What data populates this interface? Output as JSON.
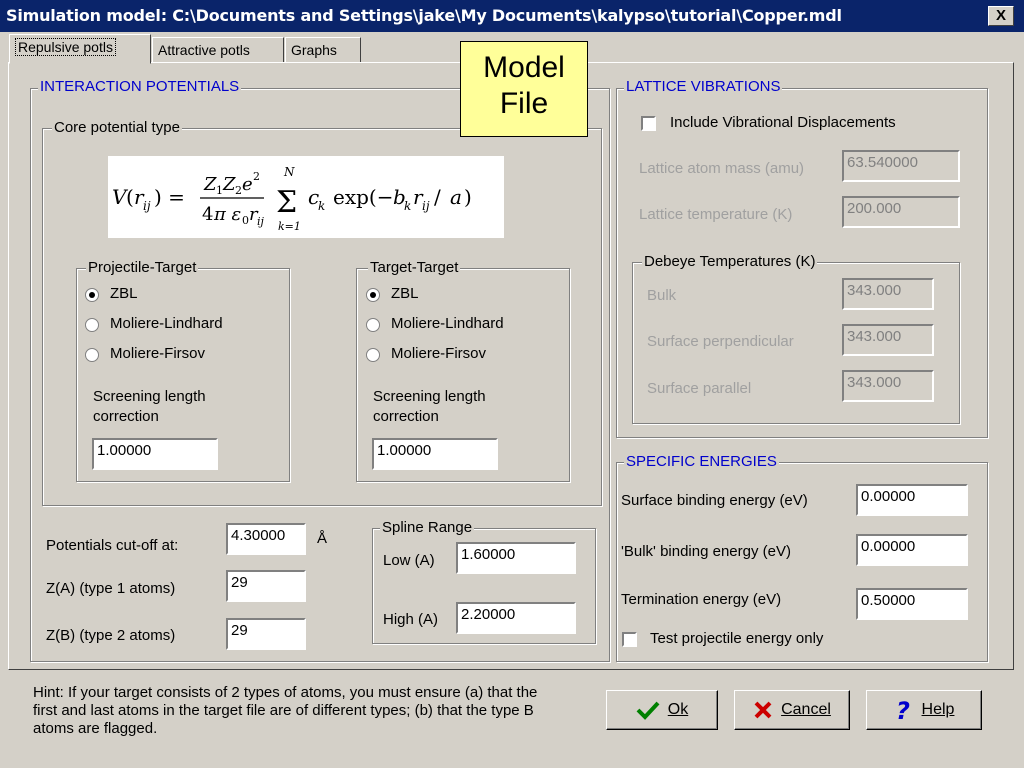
{
  "window": {
    "title": "Simulation model: C:\\Documents and Settings\\jake\\My Documents\\kalypso\\tutorial\\Copper.mdl",
    "close_label": "X"
  },
  "tabs": [
    {
      "label": "Repulsive potls"
    },
    {
      "label": "Attractive potls"
    },
    {
      "label": "Graphs"
    }
  ],
  "callout": {
    "line1": "Model",
    "line2": "File"
  },
  "interaction": {
    "title": "INTERACTION POTENTIALS",
    "core": {
      "title": "Core potential type",
      "formula": "V(r_ij) = Z1 Z2 e^2 / (4 pi eps0 r_ij) * sum_{k=1}^{N} c_k exp(-b_k r_ij / a)",
      "projectile_target": {
        "title": "Projectile-Target",
        "options": [
          "ZBL",
          "Moliere-Lindhard",
          "Moliere-Firsov"
        ],
        "selected": "ZBL",
        "screening_label_1": "Screening length",
        "screening_label_2": "correction",
        "screening_value": "1.00000"
      },
      "target_target": {
        "title": "Target-Target",
        "options": [
          "ZBL",
          "Moliere-Lindhard",
          "Moliere-Firsov"
        ],
        "selected": "ZBL",
        "screening_label_1": "Screening length",
        "screening_label_2": "correction",
        "screening_value": "1.00000"
      }
    },
    "cutoff_label": "Potentials cut-off at:",
    "cutoff_value": "4.30000",
    "cutoff_unit": "Å",
    "za_label": "Z(A) (type 1 atoms)",
    "za_value": "29",
    "zb_label": "Z(B) (type 2 atoms)",
    "zb_value": "29",
    "spline": {
      "title": "Spline Range",
      "low_label": "Low (A)",
      "low_value": "1.60000",
      "high_label": "High (A)",
      "high_value": "2.20000"
    }
  },
  "lattice": {
    "title": "LATTICE VIBRATIONS",
    "include_label": "Include Vibrational Displacements",
    "include_checked": false,
    "mass_label": "Lattice atom mass (amu)",
    "mass_value": "63.540000",
    "temp_label": "Lattice temperature (K)",
    "temp_value": "200.000",
    "debye": {
      "title": "Debeye Temperatures (K)",
      "bulk_label": "Bulk",
      "bulk_value": "343.000",
      "perp_label": "Surface perpendicular",
      "perp_value": "343.000",
      "par_label": "Surface parallel",
      "par_value": "343.000"
    }
  },
  "energies": {
    "title": "SPECIFIC ENERGIES",
    "surface_label": "Surface binding energy (eV)",
    "surface_value": "0.00000",
    "bulk_label": "'Bulk' binding energy (eV)",
    "bulk_value": "0.00000",
    "term_label": "Termination energy (eV)",
    "term_value": "0.50000",
    "test_label": "Test projectile energy only",
    "test_checked": false
  },
  "hint": "Hint: If your target consists of 2 types of atoms, you must ensure (a) that the first and last atoms in the target file are of different types; (b) that the type B atoms are flagged.",
  "buttons": {
    "ok_label": "Ok",
    "cancel_label": "Cancel",
    "help_label": "Help"
  },
  "colors": {
    "titlebar": "#0a246a",
    "group_title": "#0000cc",
    "callout": "#ffff99",
    "ok_icon": "#008000",
    "cancel_icon": "#cc0000",
    "help_icon": "#0000cc"
  }
}
